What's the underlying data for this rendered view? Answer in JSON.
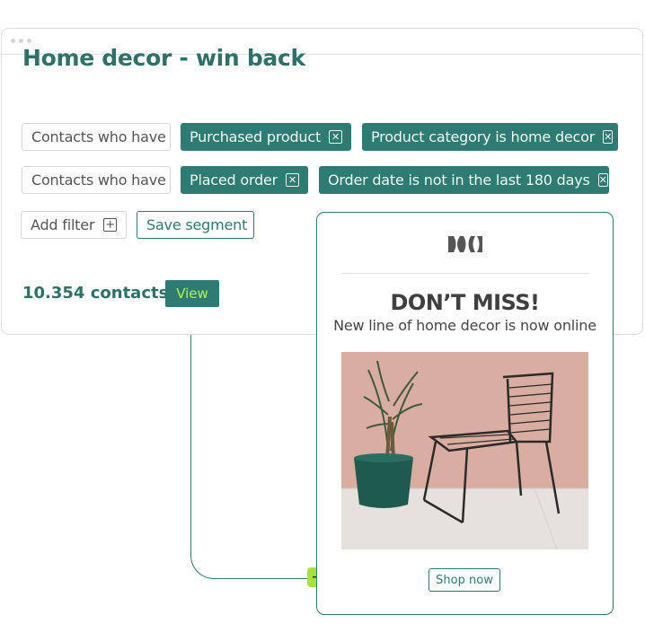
{
  "segment": {
    "title": "Home decor - win back",
    "rows": [
      {
        "prefix": "Contacts who have",
        "conditions": [
          "Purchased product",
          "Product category is home decor"
        ]
      },
      {
        "prefix": "Contacts who have",
        "conditions": [
          "Placed order",
          "Order date is not in the last 180 days"
        ]
      }
    ],
    "add_filter_label": "Add filter",
    "save_segment_label": "Save segment",
    "contacts_count": "10.354 contacts",
    "view_label": "View"
  },
  "email": {
    "headline": "DON’T MISS!",
    "subline": "New line of home decor is now online",
    "cta_label": "Shop now"
  },
  "colors": {
    "brand_teal": "#2d7b72",
    "accent_lime": "#a8e23b",
    "title_text": "#2e7166"
  },
  "icons": [
    "remove-condition-icon",
    "plus-icon",
    "arrow-right-icon",
    "brand-logo"
  ]
}
